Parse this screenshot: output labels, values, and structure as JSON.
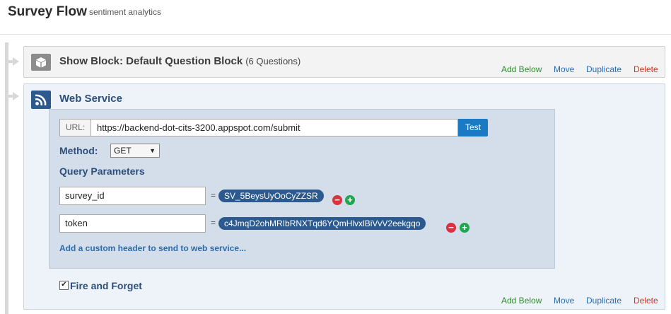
{
  "header": {
    "title": "Survey Flow",
    "subtitle": "sentiment analytics"
  },
  "actions": {
    "add_below": "Add Below",
    "move": "Move",
    "duplicate": "Duplicate",
    "delete": "Delete"
  },
  "show_block": {
    "title": "Show Block: Default Question Block",
    "question_count": "(6 Questions)",
    "icon": "cube-icon"
  },
  "web_service": {
    "title": "Web Service",
    "icon": "rss-icon",
    "url_label": "URL:",
    "url_value": "https://backend-dot-cits-3200.appspot.com/submit",
    "test_label": "Test",
    "method_label": "Method:",
    "method_value": "GET",
    "query_params_label": "Query Parameters",
    "params": [
      {
        "name": "survey_id",
        "value": "SV_5BeysUyOoCyZZSR"
      },
      {
        "name": "token",
        "value": "c4JmqD2ohMRIbRNXTqd6YQmHlvxlBiVvV2eekgqo"
      }
    ],
    "custom_header_link": "Add a custom header to send to web service...",
    "fire_and_forget_label": "Fire and Forget",
    "fire_and_forget_checked": true
  },
  "colors": {
    "accent_blue": "#2d5a8e",
    "link_blue": "#2a6cb0",
    "add_green": "#2e8b2e",
    "delete_red": "#d0321e"
  }
}
